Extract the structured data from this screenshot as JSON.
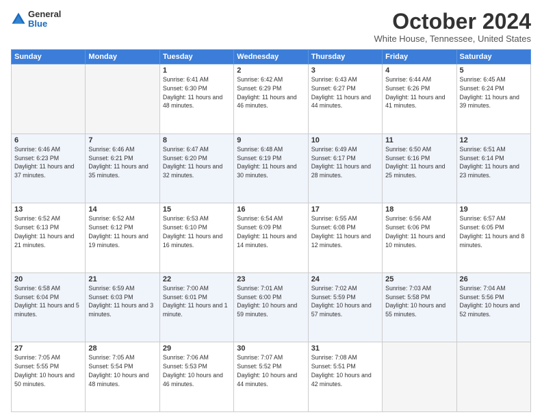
{
  "header": {
    "logo_general": "General",
    "logo_blue": "Blue",
    "month": "October 2024",
    "location": "White House, Tennessee, United States"
  },
  "days_of_week": [
    "Sunday",
    "Monday",
    "Tuesday",
    "Wednesday",
    "Thursday",
    "Friday",
    "Saturday"
  ],
  "weeks": [
    [
      {
        "num": "",
        "info": ""
      },
      {
        "num": "",
        "info": ""
      },
      {
        "num": "1",
        "info": "Sunrise: 6:41 AM\nSunset: 6:30 PM\nDaylight: 11 hours and 48 minutes."
      },
      {
        "num": "2",
        "info": "Sunrise: 6:42 AM\nSunset: 6:29 PM\nDaylight: 11 hours and 46 minutes."
      },
      {
        "num": "3",
        "info": "Sunrise: 6:43 AM\nSunset: 6:27 PM\nDaylight: 11 hours and 44 minutes."
      },
      {
        "num": "4",
        "info": "Sunrise: 6:44 AM\nSunset: 6:26 PM\nDaylight: 11 hours and 41 minutes."
      },
      {
        "num": "5",
        "info": "Sunrise: 6:45 AM\nSunset: 6:24 PM\nDaylight: 11 hours and 39 minutes."
      }
    ],
    [
      {
        "num": "6",
        "info": "Sunrise: 6:46 AM\nSunset: 6:23 PM\nDaylight: 11 hours and 37 minutes."
      },
      {
        "num": "7",
        "info": "Sunrise: 6:46 AM\nSunset: 6:21 PM\nDaylight: 11 hours and 35 minutes."
      },
      {
        "num": "8",
        "info": "Sunrise: 6:47 AM\nSunset: 6:20 PM\nDaylight: 11 hours and 32 minutes."
      },
      {
        "num": "9",
        "info": "Sunrise: 6:48 AM\nSunset: 6:19 PM\nDaylight: 11 hours and 30 minutes."
      },
      {
        "num": "10",
        "info": "Sunrise: 6:49 AM\nSunset: 6:17 PM\nDaylight: 11 hours and 28 minutes."
      },
      {
        "num": "11",
        "info": "Sunrise: 6:50 AM\nSunset: 6:16 PM\nDaylight: 11 hours and 25 minutes."
      },
      {
        "num": "12",
        "info": "Sunrise: 6:51 AM\nSunset: 6:14 PM\nDaylight: 11 hours and 23 minutes."
      }
    ],
    [
      {
        "num": "13",
        "info": "Sunrise: 6:52 AM\nSunset: 6:13 PM\nDaylight: 11 hours and 21 minutes."
      },
      {
        "num": "14",
        "info": "Sunrise: 6:52 AM\nSunset: 6:12 PM\nDaylight: 11 hours and 19 minutes."
      },
      {
        "num": "15",
        "info": "Sunrise: 6:53 AM\nSunset: 6:10 PM\nDaylight: 11 hours and 16 minutes."
      },
      {
        "num": "16",
        "info": "Sunrise: 6:54 AM\nSunset: 6:09 PM\nDaylight: 11 hours and 14 minutes."
      },
      {
        "num": "17",
        "info": "Sunrise: 6:55 AM\nSunset: 6:08 PM\nDaylight: 11 hours and 12 minutes."
      },
      {
        "num": "18",
        "info": "Sunrise: 6:56 AM\nSunset: 6:06 PM\nDaylight: 11 hours and 10 minutes."
      },
      {
        "num": "19",
        "info": "Sunrise: 6:57 AM\nSunset: 6:05 PM\nDaylight: 11 hours and 8 minutes."
      }
    ],
    [
      {
        "num": "20",
        "info": "Sunrise: 6:58 AM\nSunset: 6:04 PM\nDaylight: 11 hours and 5 minutes."
      },
      {
        "num": "21",
        "info": "Sunrise: 6:59 AM\nSunset: 6:03 PM\nDaylight: 11 hours and 3 minutes."
      },
      {
        "num": "22",
        "info": "Sunrise: 7:00 AM\nSunset: 6:01 PM\nDaylight: 11 hours and 1 minute."
      },
      {
        "num": "23",
        "info": "Sunrise: 7:01 AM\nSunset: 6:00 PM\nDaylight: 10 hours and 59 minutes."
      },
      {
        "num": "24",
        "info": "Sunrise: 7:02 AM\nSunset: 5:59 PM\nDaylight: 10 hours and 57 minutes."
      },
      {
        "num": "25",
        "info": "Sunrise: 7:03 AM\nSunset: 5:58 PM\nDaylight: 10 hours and 55 minutes."
      },
      {
        "num": "26",
        "info": "Sunrise: 7:04 AM\nSunset: 5:56 PM\nDaylight: 10 hours and 52 minutes."
      }
    ],
    [
      {
        "num": "27",
        "info": "Sunrise: 7:05 AM\nSunset: 5:55 PM\nDaylight: 10 hours and 50 minutes."
      },
      {
        "num": "28",
        "info": "Sunrise: 7:05 AM\nSunset: 5:54 PM\nDaylight: 10 hours and 48 minutes."
      },
      {
        "num": "29",
        "info": "Sunrise: 7:06 AM\nSunset: 5:53 PM\nDaylight: 10 hours and 46 minutes."
      },
      {
        "num": "30",
        "info": "Sunrise: 7:07 AM\nSunset: 5:52 PM\nDaylight: 10 hours and 44 minutes."
      },
      {
        "num": "31",
        "info": "Sunrise: 7:08 AM\nSunset: 5:51 PM\nDaylight: 10 hours and 42 minutes."
      },
      {
        "num": "",
        "info": ""
      },
      {
        "num": "",
        "info": ""
      }
    ]
  ]
}
